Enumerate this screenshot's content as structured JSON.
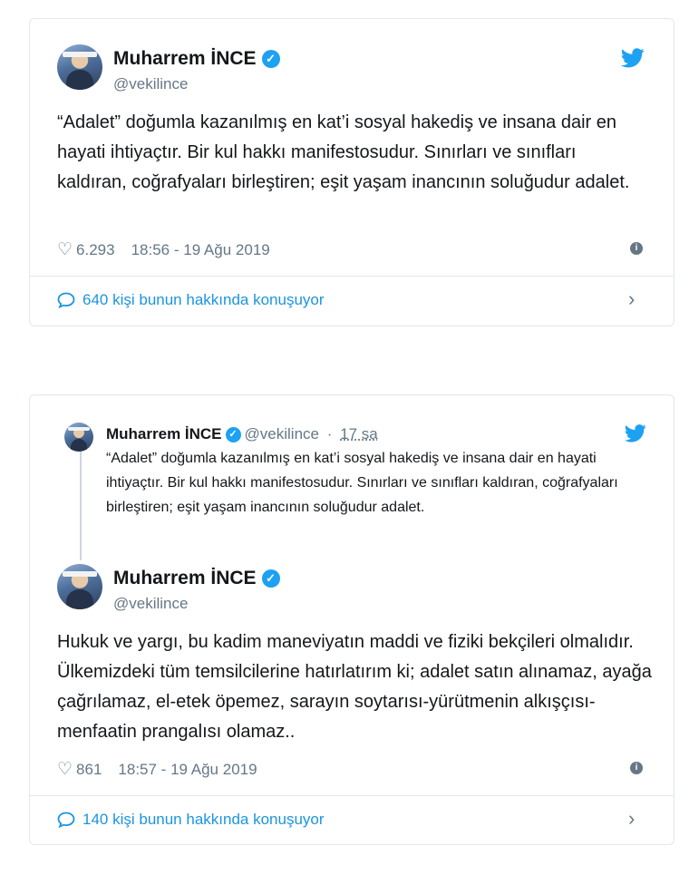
{
  "tweet1": {
    "name": "Muharrem İNCE",
    "handle": "@vekilince",
    "text": "“Adalet” doğumla kazanılmış en kat’i sosyal hakediş ve insana dair en hayati ihtiyaçtır. Bir kul hakkı manifestosudur. Sınırları ve sınıfları kaldıran, coğrafyaları birleştiren; eşit yaşam inancının soluğudur adalet.",
    "likes": "6.293",
    "timestamp": "18:56 - 19 Ağu 2019",
    "conversation": "640 kişi bunun hakkında konuşuyor"
  },
  "tweet2": {
    "quoted": {
      "name": "Muharrem İNCE",
      "handle": "@vekilince",
      "separator": "·",
      "time": "17 sa",
      "text": "“Adalet” doğumla kazanılmış en kat’i sosyal hakediş ve insana dair en hayati ihtiyaçtır. Bir kul hakkı manifestosudur. Sınırları ve sınıfları kaldıran, coğrafyaları birleştiren; eşit yaşam inancının soluğudur adalet."
    },
    "name": "Muharrem İNCE",
    "handle": "@vekilince",
    "text": "Hukuk ve yargı, bu kadim maneviyatın maddi ve fiziki bekçileri olmalıdır.  Ülkemizdeki tüm temsilcilerine hatırlatırım ki; adalet satın alınamaz, ayağa çağrılamaz, el-etek öpemez, sarayın soytarısı-yürütmenin alkışçısı-menfaatin prangalısı olamaz..",
    "likes": "861",
    "timestamp": "18:57 - 19 Ağu 2019",
    "conversation": "140 kişi bunun hakkında konuşuyor"
  },
  "icons": {
    "verified": "verified-badge-icon",
    "bird": "twitter-bird-icon",
    "heart": "heart-icon",
    "info": "info-icon",
    "bubble": "speech-bubble-icon",
    "chevron": "chevron-right-icon"
  },
  "colors": {
    "accent": "#1da1f2",
    "link": "#1b95e0",
    "muted": "#657786",
    "border": "#e1e8ed"
  }
}
